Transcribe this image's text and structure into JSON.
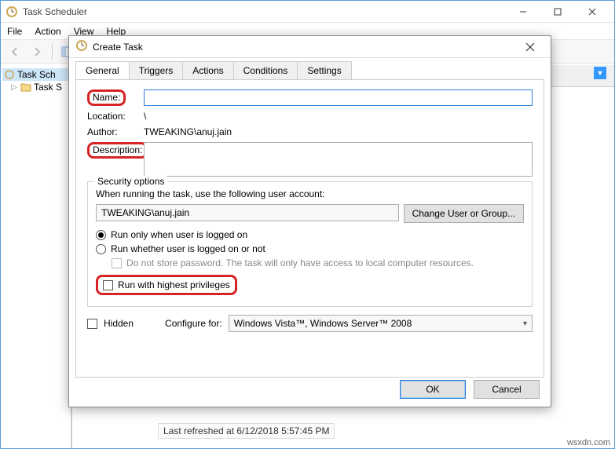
{
  "window": {
    "title": "Task Scheduler",
    "menus": [
      "File",
      "Action",
      "View",
      "Help"
    ],
    "tree": {
      "root": "Task Sch",
      "child": "Task S"
    },
    "status": "Last refreshed at 6/12/2018 5:57:45 PM"
  },
  "dialog": {
    "title": "Create Task",
    "tabs": [
      "General",
      "Triggers",
      "Actions",
      "Conditions",
      "Settings"
    ],
    "name_label": "Name:",
    "name_value": "",
    "location_label": "Location:",
    "location_value": "\\",
    "author_label": "Author:",
    "author_value": "TWEAKING\\anuj.jain",
    "description_label": "Description:",
    "description_value": "",
    "security": {
      "legend": "Security options",
      "when_running": "When running the task, use the following user account:",
      "user": "TWEAKING\\anuj.jain",
      "change_user_btn": "Change User or Group...",
      "radio_logged_on": "Run only when user is logged on",
      "radio_whether": "Run whether user is logged on or not",
      "no_store_pw": "Do not store password. The task will only have access to local computer resources.",
      "highest_priv": "Run with highest privileges"
    },
    "hidden_label": "Hidden",
    "configure_label": "Configure for:",
    "configure_value": "Windows Vista™, Windows Server™ 2008",
    "ok": "OK",
    "cancel": "Cancel"
  },
  "watermark": "wsxdn.com"
}
